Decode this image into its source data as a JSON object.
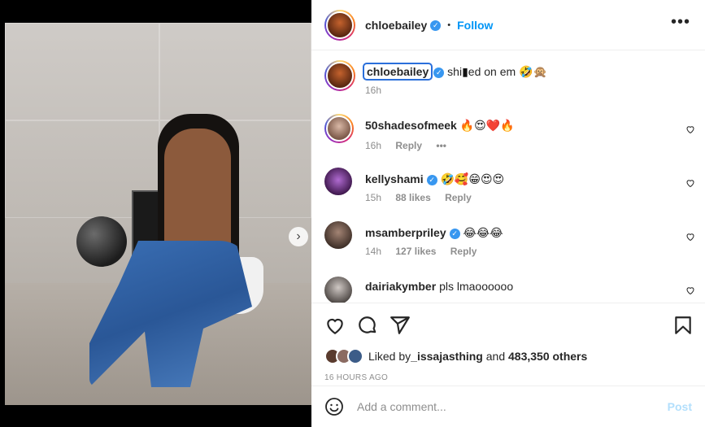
{
  "post": {
    "author": "chloebailey",
    "follow_label": "Follow",
    "separator": "•",
    "more_label": "•••",
    "caption": {
      "username": "chloebailey",
      "text": "shi",
      "redacted": "▮",
      "text_after": "ed on em 🤣🙊",
      "time": "16h"
    },
    "media": {
      "next_label": "›",
      "slide_count": 5,
      "active_slide": 0
    }
  },
  "comments": [
    {
      "username": "50shadesofmeek",
      "verified": false,
      "text": "🔥😍❤️🔥",
      "time": "16h",
      "likes": "",
      "reply": "Reply",
      "more": "•••"
    },
    {
      "username": "kellyshami",
      "verified": true,
      "text": "🤣🥰😁😍😍",
      "time": "15h",
      "likes": "88 likes",
      "reply": "Reply"
    },
    {
      "username": "msamberpriley",
      "verified": true,
      "text": "😂😂😂",
      "time": "14h",
      "likes": "127 likes",
      "reply": "Reply"
    },
    {
      "username": "dairiakymber",
      "verified": false,
      "text": "pls lmaoooooo",
      "time": "",
      "likes": "",
      "reply": ""
    }
  ],
  "likes_summary": {
    "prefix": "Liked by ",
    "user": "_issajasthing",
    "middle": " and ",
    "others": "483,350 others"
  },
  "timestamp": "16 HOURS AGO",
  "add_comment": {
    "placeholder": "Add a comment...",
    "post_label": "Post"
  },
  "colors": {
    "accent": "#0095f6",
    "verified": "#3897f0",
    "post_disabled": "#b2dffc",
    "muted": "#8e8e8e"
  },
  "icons": [
    "heart-icon",
    "comment-icon",
    "share-icon",
    "bookmark-icon",
    "emoji-icon",
    "verified-icon",
    "more-icon",
    "chevron-right-icon"
  ]
}
